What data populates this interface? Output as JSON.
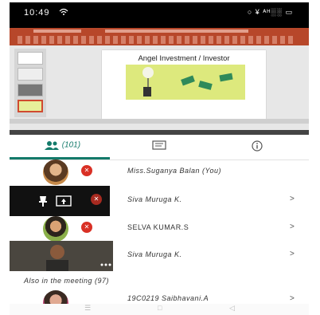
{
  "status_bar": {
    "time": "10:49",
    "right": "○ ¥ ᴬᴴ░░ ▭"
  },
  "shared_screen": {
    "slide_title": "Angel Investment / Investor"
  },
  "tabs": {
    "people_count": "(101)"
  },
  "participants": [
    {
      "name": "Miss.Suganya Balan (You)",
      "muted": true,
      "chevron": ""
    },
    {
      "name": "Siva Muruga K.",
      "muted": true,
      "chevron": ">"
    },
    {
      "name": "SELVA KUMAR.S",
      "muted": true,
      "chevron": ">"
    },
    {
      "name": "Siva Muruga K.",
      "muted": false,
      "chevron": ">"
    }
  ],
  "also_in_meeting": "Also in the meeting (97)",
  "last_participant": {
    "name": "19C0219 Saibhavani.A",
    "chevron": ">"
  },
  "colors": {
    "accent": "#137a6a",
    "mute_red": "#d93025",
    "ppt_red": "#b7472a"
  },
  "icons": [
    "wifi-icon",
    "people-icon",
    "chat-icon",
    "info-icon",
    "mic-off-icon",
    "present-icon",
    "chevron-right-icon"
  ]
}
